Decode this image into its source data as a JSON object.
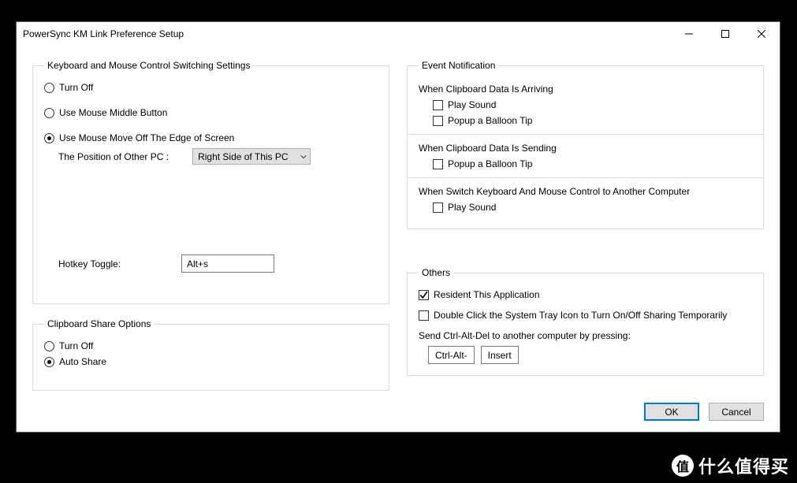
{
  "window": {
    "title": "PowerSync KM Link Preference Setup"
  },
  "kbm": {
    "legend": "Keyboard and Mouse Control Switching Settings",
    "turn_off": "Turn Off",
    "middle_button": "Use Mouse Middle Button",
    "move_edge": "Use Mouse Move Off The Edge of Screen",
    "position_label": "The Position of Other PC :",
    "position_value": "Right Side of This PC",
    "hotkey_label": "Hotkey Toggle:",
    "hotkey_value": "Alt+s"
  },
  "clipshare": {
    "legend": "Clipboard Share Options",
    "turn_off": "Turn Off",
    "auto_share": "Auto Share"
  },
  "event": {
    "legend": "Event Notification",
    "arriving_label": "When Clipboard Data Is Arriving",
    "play_sound": "Play Sound",
    "balloon_tip": "Popup a Balloon Tip",
    "sending_label": "When Clipboard Data Is Sending",
    "switch_label": "When Switch Keyboard And Mouse Control to Another Computer"
  },
  "others": {
    "legend": "Others",
    "resident": "Resident This Application",
    "dblclick": "Double Click the System Tray Icon to Turn On/Off Sharing Temporarily",
    "cad_label": "Send Ctrl-Alt-Del to another computer by pressing:",
    "cad_prefix": "Ctrl-Alt-",
    "cad_key": "Insert"
  },
  "buttons": {
    "ok": "OK",
    "cancel": "Cancel"
  },
  "watermark": {
    "badge": "值",
    "text": "什么值得买"
  }
}
